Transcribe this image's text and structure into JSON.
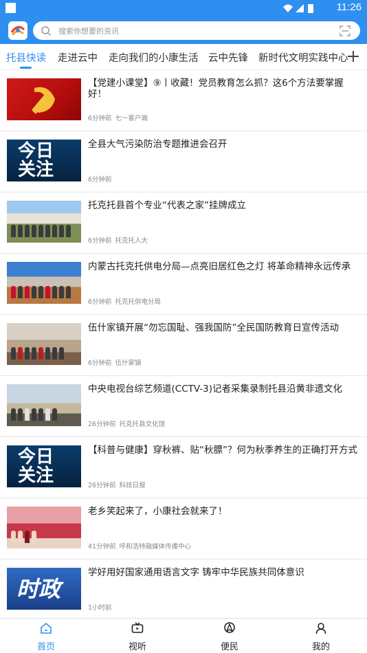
{
  "status": {
    "time": "11:26"
  },
  "search": {
    "placeholder": "搜索你想要的资讯"
  },
  "tabs": [
    {
      "label": "托县快读",
      "active": true
    },
    {
      "label": "走进云中"
    },
    {
      "label": "走向我们的小康生活"
    },
    {
      "label": "云中先锋"
    },
    {
      "label": "新时代文明实践中心"
    }
  ],
  "articles": [
    {
      "title": "【党建小课堂】⑨丨收藏！党员教育怎么抓？这6个方法要掌握好！",
      "time": "6分钟前",
      "source": "七一客户端"
    },
    {
      "title": "全县大气污染防治专题推进会召开",
      "time": "6分钟前",
      "source": "",
      "thumb_text": "今日\n关注"
    },
    {
      "title": "托克托县首个专业“代表之家”挂牌成立",
      "time": "6分钟前",
      "source": "托克托人大"
    },
    {
      "title": "内蒙古托克托供电分局—点亮旧居红色之灯  将革命精神永远传承",
      "time": "6分钟前",
      "source": "托克托供电分局"
    },
    {
      "title": "伍什家镇开展“勿忘国耻、强我国防”全民国防教育日宣传活动",
      "time": "6分钟前",
      "source": "伍什家镇"
    },
    {
      "title": "中央电视台综艺频道(CCTV-3)记者采集录制托县沿黄非遗文化",
      "time": "26分钟前",
      "source": "托克托县文化馆"
    },
    {
      "title": "【科普与健康】穿秋裤、贴“秋膘”？何为秋季养生的正确打开方式",
      "time": "26分钟前",
      "source": "科技日报",
      "thumb_text": "今日\n关注"
    },
    {
      "title": "老乡笑起来了，小康社会就来了！",
      "time": "41分钟前",
      "source": "呼和浩特融媒体传播中心"
    },
    {
      "title": "学好用好国家通用语言文字  铸牢中华民族共同体意识",
      "time": "1小时前",
      "source": "",
      "thumb_text": "时政"
    }
  ],
  "bottom_nav": [
    {
      "label": "首页",
      "icon": "home-icon",
      "active": true
    },
    {
      "label": "视听",
      "icon": "tv-icon"
    },
    {
      "label": "便民",
      "icon": "location-icon"
    },
    {
      "label": "我的",
      "icon": "user-icon"
    }
  ],
  "colors": {
    "accent": "#2f8ff0"
  }
}
